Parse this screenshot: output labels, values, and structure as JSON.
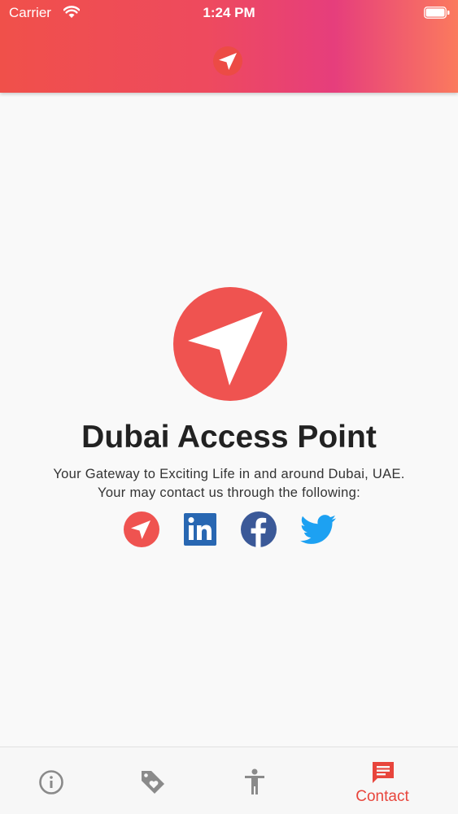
{
  "status_bar": {
    "carrier": "Carrier",
    "time": "1:24 PM",
    "wifi_icon": "wifi-icon",
    "battery_icon": "battery-icon"
  },
  "header": {
    "logo_icon": "paper-plane-logo-icon"
  },
  "main": {
    "title": "Dubai Access Point",
    "tagline": "Your Gateway to Exciting Life in and around Dubai, UAE.",
    "contact_line": "Your may contact us through the following:",
    "social": [
      "paper-plane-icon",
      "linkedin-icon",
      "facebook-icon",
      "twitter-icon"
    ]
  },
  "tabbar": {
    "tabs": [
      {
        "icon": "info-icon",
        "label": ""
      },
      {
        "icon": "tag-heart-icon",
        "label": ""
      },
      {
        "icon": "accessibility-icon",
        "label": ""
      },
      {
        "icon": "message-icon",
        "label": "Contact",
        "active": true
      }
    ]
  },
  "colors": {
    "brand_red": "#ef5350",
    "linkedin": "#2867b2",
    "facebook": "#3b5998",
    "twitter": "#1da1f2",
    "tab_inactive": "#8a8a8a",
    "tab_active": "#e8453c"
  }
}
